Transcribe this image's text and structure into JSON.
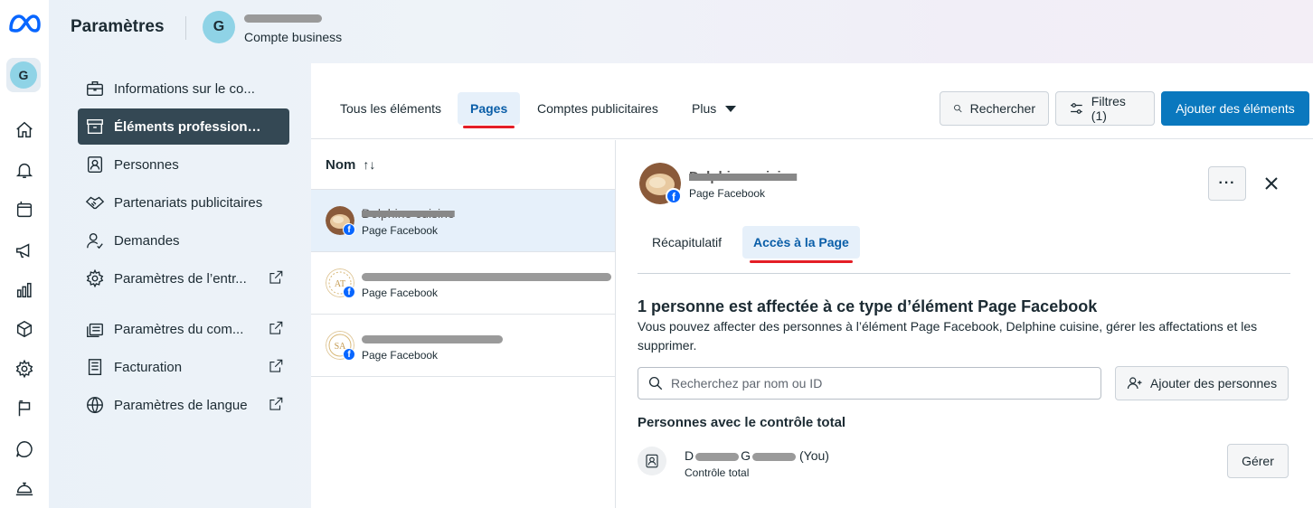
{
  "header": {
    "title": "Paramètres",
    "avatar_letter": "G",
    "account_type": "Compte business"
  },
  "rail": {
    "avatar_letter": "G",
    "icons": [
      "meta-logo",
      "home-icon",
      "bell-icon",
      "pages-icon",
      "megaphone-icon",
      "bar-chart-icon",
      "cube-icon",
      "gear-icon",
      "flag-icon",
      "chat-icon",
      "bell-service-icon"
    ]
  },
  "sidebar": {
    "items": [
      {
        "label": "Informations sur le co...",
        "icon": "briefcase-icon",
        "external": false
      },
      {
        "label": "Éléments professionnels",
        "icon": "archive-icon",
        "external": false,
        "active": true
      },
      {
        "label": "Personnes",
        "icon": "person-badge-icon",
        "external": false
      },
      {
        "label": "Partenariats publicitaires",
        "icon": "handshake-icon",
        "external": false
      },
      {
        "label": "Demandes",
        "icon": "person-check-icon",
        "external": false
      },
      {
        "label": "Paramètres de l’entr...",
        "icon": "gear-icon",
        "external": true
      },
      {
        "label": "Paramètres du com...",
        "icon": "stack-icon",
        "external": true
      },
      {
        "label": "Facturation",
        "icon": "receipt-icon",
        "external": true
      },
      {
        "label": "Paramètres de langue",
        "icon": "globe-icon",
        "external": true
      }
    ]
  },
  "tabs": {
    "all": "Tous les éléments",
    "pages": "Pages",
    "ad_accounts": "Comptes publicitaires",
    "more": "Plus"
  },
  "toolbar": {
    "search": "Rechercher",
    "filters": "Filtres (1)",
    "add": "Ajouter des éléments"
  },
  "list": {
    "header": "Nom",
    "sort_glyph": "↑↓",
    "rows": [
      {
        "name": "Delphine cuisine",
        "type": "Page Facebook",
        "selected": true
      },
      {
        "name": "",
        "type": "Page Facebook",
        "selected": false
      },
      {
        "name": "",
        "type": "Page Facebook",
        "selected": false
      }
    ]
  },
  "detail": {
    "name": "Delphine cuisine",
    "type": "Page Facebook",
    "more_glyph": "···",
    "tabs": {
      "summary": "Récapitulatif",
      "access": "Accès à la Page"
    },
    "heading": "1 personne est affectée à ce type d’élément Page Facebook",
    "description": "Vous pouvez affecter des personnes à l’élément Page Facebook, Delphine cuisine, gérer les affectations et les supprimer.",
    "search_placeholder": "Recherchez par nom ou ID",
    "add_people": "Ajouter des personnes",
    "section_title": "Personnes avec le contrôle total",
    "person": {
      "name_prefix": "D",
      "name_mid": "G",
      "you": "(You)",
      "role": "Contrôle total",
      "manage": "Gérer"
    }
  },
  "colors": {
    "accent_blue": "#0a78be",
    "active_nav": "#344854",
    "tab_underline": "#e41e26",
    "facebook_blue": "#0866ff"
  }
}
